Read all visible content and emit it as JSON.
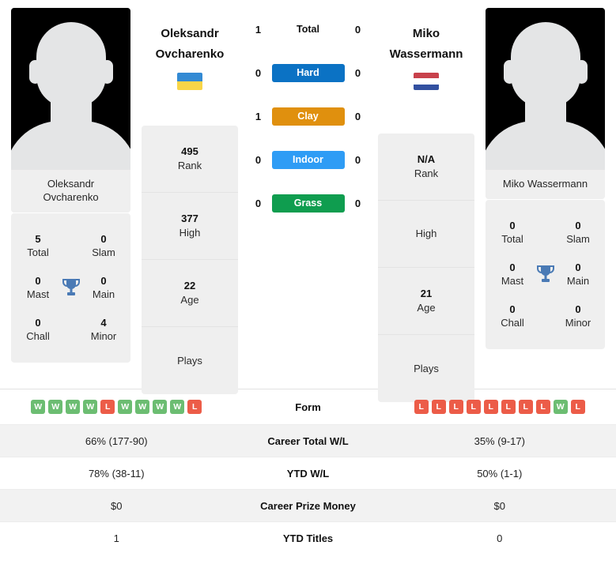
{
  "players": {
    "left": {
      "first_name": "Oleksandr",
      "last_name": "Ovcharenko",
      "full_name": "Oleksandr Ovcharenko",
      "photo_caption_line1": "Oleksandr",
      "photo_caption_line2": "Ovcharenko",
      "country_flag": "ukraine-flag",
      "flag_colors": [
        "#338ad4",
        "#f8d548"
      ],
      "info": [
        {
          "value": "495",
          "label": "Rank"
        },
        {
          "value": "377",
          "label": "High"
        },
        {
          "value": "22",
          "label": "Age"
        },
        {
          "value": "",
          "label": "Plays"
        }
      ],
      "titles": [
        {
          "value": "5",
          "label": "Total"
        },
        {
          "value": "0",
          "label": "Slam"
        },
        {
          "value": "0",
          "label": "Mast"
        },
        {
          "value": "0",
          "label": "Main"
        },
        {
          "value": "0",
          "label": "Chall"
        },
        {
          "value": "4",
          "label": "Minor"
        }
      ],
      "form": [
        "W",
        "W",
        "W",
        "W",
        "L",
        "W",
        "W",
        "W",
        "W",
        "L"
      ]
    },
    "right": {
      "first_name": "Miko",
      "last_name": "Wassermann",
      "full_name": "Miko Wassermann",
      "photo_caption_line1": "Miko Wassermann",
      "photo_caption_line2": "",
      "country_flag": "netherlands-flag",
      "flag_colors": [
        "#c8414b",
        "#ffffff",
        "#3250a0"
      ],
      "info": [
        {
          "value": "N/A",
          "label": "Rank"
        },
        {
          "value": "",
          "label": "High"
        },
        {
          "value": "21",
          "label": "Age"
        },
        {
          "value": "",
          "label": "Plays"
        }
      ],
      "titles": [
        {
          "value": "0",
          "label": "Total"
        },
        {
          "value": "0",
          "label": "Slam"
        },
        {
          "value": "0",
          "label": "Mast"
        },
        {
          "value": "0",
          "label": "Main"
        },
        {
          "value": "0",
          "label": "Chall"
        },
        {
          "value": "0",
          "label": "Minor"
        }
      ],
      "form": [
        "L",
        "L",
        "L",
        "L",
        "L",
        "L",
        "L",
        "L",
        "W",
        "L"
      ]
    }
  },
  "head_to_head": {
    "rows": [
      {
        "surface": "Total",
        "left": "1",
        "right": "0",
        "color": "transparent",
        "plain": true
      },
      {
        "surface": "Hard",
        "left": "0",
        "right": "0",
        "color": "#0b72c4",
        "plain": false
      },
      {
        "surface": "Clay",
        "left": "1",
        "right": "0",
        "color": "#e0900e",
        "plain": false
      },
      {
        "surface": "Indoor",
        "left": "0",
        "right": "0",
        "color": "#2e9cf5",
        "plain": false
      },
      {
        "surface": "Grass",
        "left": "0",
        "right": "0",
        "color": "#0f9d4f",
        "plain": false
      }
    ]
  },
  "comparison": {
    "form_label": "Form",
    "rows": [
      {
        "label": "Career Total W/L",
        "left": "66% (177-90)",
        "right": "35% (9-17)"
      },
      {
        "label": "YTD W/L",
        "left": "78% (38-11)",
        "right": "50% (1-1)"
      },
      {
        "label": "Career Prize Money",
        "left": "$0",
        "right": "$0"
      },
      {
        "label": "YTD Titles",
        "left": "1",
        "right": "0"
      }
    ]
  },
  "theme": {
    "win_color": "#6cbd72",
    "loss_color": "#ec5c48",
    "trophy_color": "#4a7ab5",
    "panel_bg": "#efefef"
  }
}
